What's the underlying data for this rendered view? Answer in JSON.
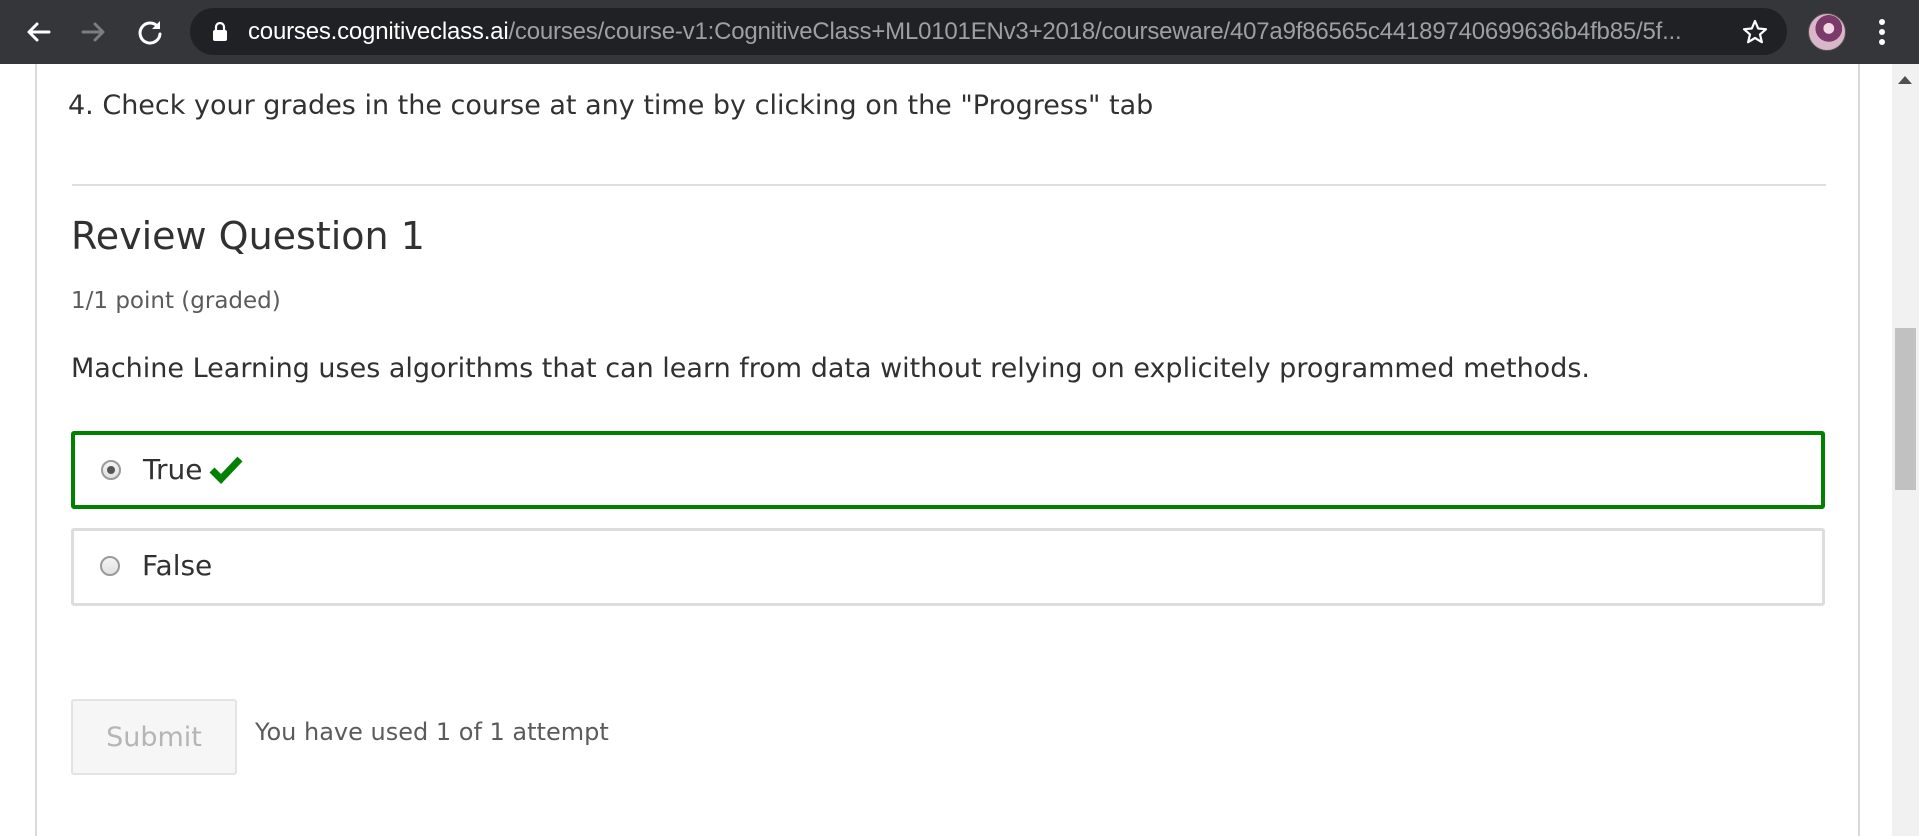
{
  "browser": {
    "url_host": "courses.cognitiveclass.ai",
    "url_path": "/courses/course-v1:CognitiveClass+ML0101ENv3+2018/courseware/407a9f86565c44189740699636b4fb85/5f...",
    "icons": {
      "back": "arrow-left-icon",
      "forward": "arrow-right-icon",
      "reload": "reload-icon",
      "lock": "lock-icon",
      "bookmark": "star-icon",
      "menu": "kebab-menu-icon"
    }
  },
  "content": {
    "instruction": "4. Check your grades in the course at any time by clicking on the \"Progress\" tab",
    "question": {
      "title": "Review Question 1",
      "points": "1/1 point (graded)",
      "text": "Machine Learning uses algorithms that can learn from data without relying on explicitely programmed methods.",
      "choices": [
        {
          "label": "True",
          "selected": true,
          "correct": true
        },
        {
          "label": "False",
          "selected": false,
          "correct": false
        }
      ],
      "submit_label": "Submit",
      "attempts_text": "You have used 1 of 1 attempt"
    }
  },
  "colors": {
    "correct_border": "#008100",
    "chrome_bg": "#35363a",
    "omnibox_bg": "#202124"
  }
}
